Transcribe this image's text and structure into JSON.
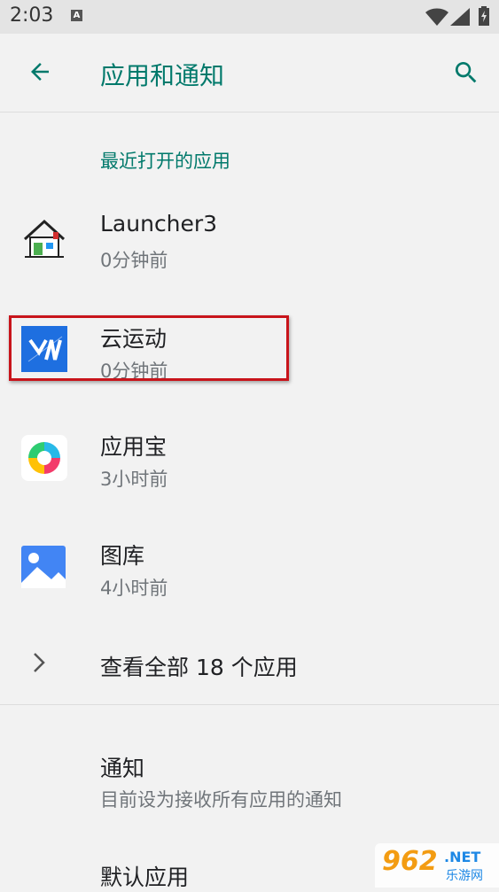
{
  "status_bar": {
    "time": "2:03",
    "notif_letter": "A"
  },
  "app_bar": {
    "title": "应用和通知",
    "back_icon": "arrow-back-icon",
    "search_icon": "search-icon"
  },
  "recent": {
    "section_label": "最近打开的应用",
    "apps": [
      {
        "name": "Launcher3",
        "time": "0分钟前",
        "icon": "launcher-house-icon"
      },
      {
        "name": "云运动",
        "time": "0分钟前",
        "icon": "yunyundong-icon",
        "highlighted": true
      },
      {
        "name": "应用宝",
        "time": "3小时前",
        "icon": "yingyongbao-icon"
      },
      {
        "name": "图库",
        "time": "4小时前",
        "icon": "gallery-icon"
      }
    ],
    "see_all_label": "查看全部 18 个应用"
  },
  "prefs": [
    {
      "title": "通知",
      "subtitle": "目前设为接收所有应用的通知"
    },
    {
      "title": "默认应用",
      "subtitle": ""
    }
  ],
  "watermark": {
    "logo": "962",
    "net": ".NET",
    "sub": "乐游网"
  },
  "colors": {
    "accent": "#00796b",
    "highlight_border": "#c8141b"
  }
}
